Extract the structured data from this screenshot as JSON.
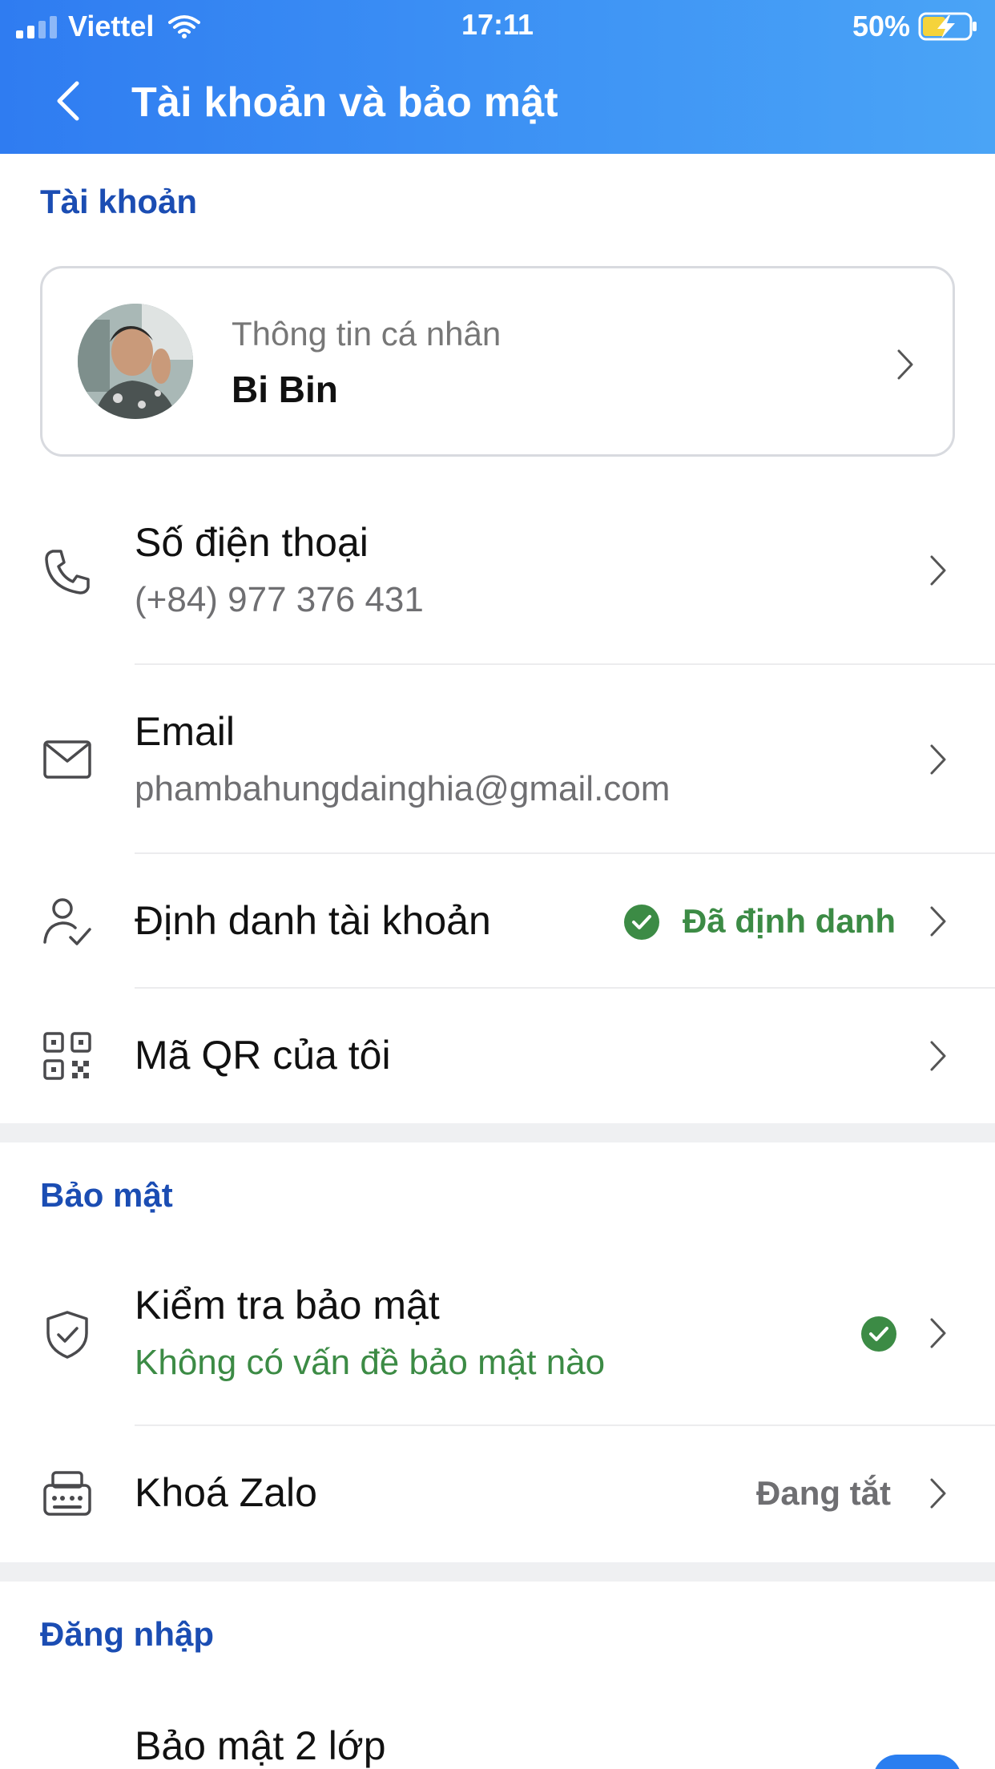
{
  "status_bar": {
    "carrier": "Viettel",
    "time": "17:11",
    "battery": "50%"
  },
  "header": {
    "title": "Tài khoản và bảo mật"
  },
  "account_section": {
    "title": "Tài khoản",
    "profile": {
      "subtitle": "Thông tin cá nhân",
      "name": "Bi Bin"
    },
    "rows": [
      {
        "title": "Số điện thoại",
        "value": "(+84) 977 376 431",
        "icon": "phone-icon"
      },
      {
        "title": "Email",
        "value": "phambahungdainghia@gmail.com",
        "icon": "mail-icon"
      },
      {
        "title": "Định danh tài khoản",
        "status": "Đã định danh",
        "icon": "user-check-icon"
      },
      {
        "title": "Mã QR của tôi",
        "icon": "qr-code-icon"
      }
    ]
  },
  "security_section": {
    "title": "Bảo mật",
    "rows": [
      {
        "title": "Kiểm tra bảo mật",
        "value": "Không có vấn đề bảo mật nào",
        "icon": "shield-check-icon"
      },
      {
        "title": "Khoá Zalo",
        "status": "Đang tắt",
        "icon": "keypad-lock-icon"
      }
    ]
  },
  "login_section": {
    "title": "Đăng nhập",
    "rows": [
      {
        "title": "Bảo mật 2 lớp"
      }
    ]
  },
  "colors": {
    "header_start": "#2f7cf1",
    "header_end": "#4aa4f6",
    "section_title": "#1b4db3",
    "success": "#3c8b45",
    "toggle": "#2a7ef0"
  }
}
